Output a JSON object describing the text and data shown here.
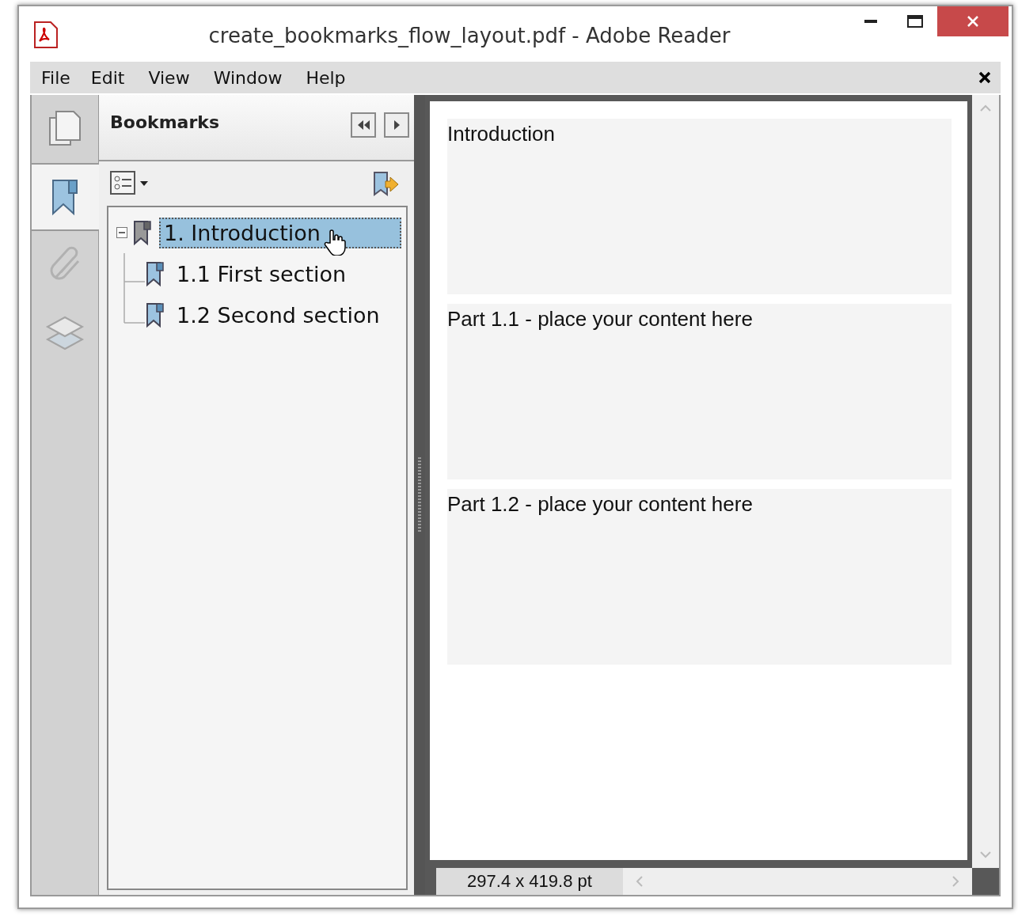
{
  "window": {
    "title": "create_bookmarks_flow_layout.pdf - Adobe Reader"
  },
  "menu": [
    "File",
    "Edit",
    "View",
    "Window",
    "Help"
  ],
  "side_tabs": [
    {
      "kind": "pages",
      "selected": false
    },
    {
      "kind": "bookmarks",
      "selected": true
    },
    {
      "kind": "attachments",
      "selected": false
    },
    {
      "kind": "layers",
      "selected": false
    }
  ],
  "panel": {
    "title": "Bookmarks"
  },
  "bookmarks": [
    {
      "label": "1. Introduction",
      "selected": true,
      "expanded": true,
      "children": [
        {
          "label": "1.1 First section",
          "selected": false
        },
        {
          "label": "1.2 Second section",
          "selected": false
        }
      ]
    }
  ],
  "page_sections": [
    "Introduction",
    "Part 1.1 - place your content here",
    "Part 1.2 - place your content here"
  ],
  "status_bar": {
    "page_size": "297.4 x 419.8 pt"
  }
}
